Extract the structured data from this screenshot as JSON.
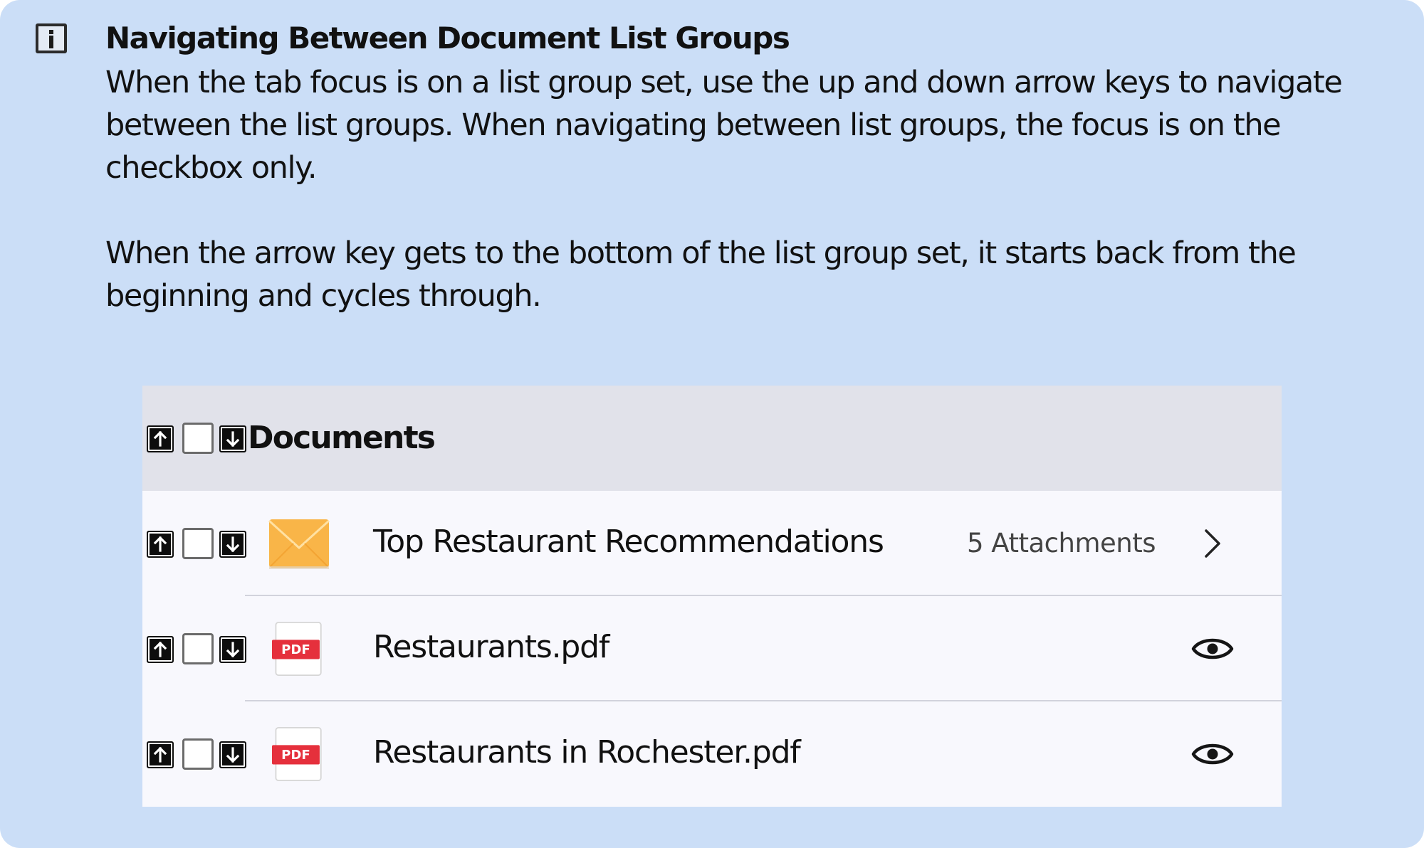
{
  "info": {
    "icon": "info-icon",
    "title": "Navigating Between Document List Groups",
    "paragraphs": [
      "When the tab focus is on a list group set, use the up and down arrow keys to navigate between the list groups. When navigating between list groups, the focus is on the checkbox only.",
      "When the arrow key gets to the bottom of the list group set, it starts back from the beginning and cycles through."
    ]
  },
  "list": {
    "header": {
      "label": "Documents",
      "up_icon": "arrow-up-key-icon",
      "down_icon": "arrow-down-key-icon",
      "checked": false
    },
    "rows": [
      {
        "icon": "envelope-icon",
        "label": "Top Restaurant Recommendations",
        "meta": "5 Attachments",
        "action_icon": "chevron-right-icon",
        "checked": false
      },
      {
        "icon": "pdf-file-icon",
        "badge": "PDF",
        "label": "Restaurants.pdf",
        "action_icon": "eye-icon",
        "checked": false
      },
      {
        "icon": "pdf-file-icon",
        "badge": "PDF",
        "label": "Restaurants in Rochester.pdf",
        "action_icon": "eye-icon",
        "checked": false
      }
    ]
  },
  "colors": {
    "panel_background": "#cbdef7",
    "header_background": "#e1e2ea",
    "row_background": "#f8f8fd",
    "envelope": "#f9b548",
    "pdf_badge": "#e5303c"
  }
}
